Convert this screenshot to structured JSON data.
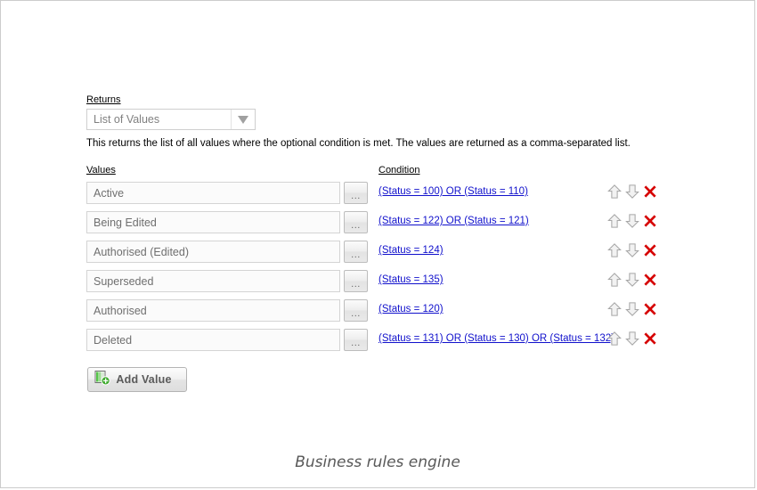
{
  "returns": {
    "label": "Returns",
    "selected_value": "List of Values",
    "dropdown_icon": "chevron-down-icon"
  },
  "description": "This returns the list of all values where the optional condition is met. The values are returned as a comma-separated list.",
  "table": {
    "headers": {
      "values": "Values",
      "condition": "Condition"
    },
    "ellipsis_label": "...",
    "row_icons": {
      "move_up": "arrow-up-icon",
      "move_down": "arrow-down-icon",
      "delete": "delete-x-icon"
    },
    "rows": [
      {
        "value": "Active",
        "condition": "(Status = 100) OR (Status = 110)"
      },
      {
        "value": "Being Edited",
        "condition": "(Status = 122) OR (Status = 121)"
      },
      {
        "value": "Authorised (Edited)",
        "condition": "(Status = 124)"
      },
      {
        "value": "Superseded",
        "condition": "(Status = 135)"
      },
      {
        "value": "Authorised",
        "condition": "(Status = 120)"
      },
      {
        "value": "Deleted",
        "condition": "(Status = 131) OR (Status = 130) OR (Status = 132)"
      }
    ]
  },
  "add_value": {
    "label": "Add Value",
    "icon": "add-value-icon"
  },
  "caption": "Business rules engine",
  "colors": {
    "link": "#1111CC",
    "delete": "#D60000",
    "page_border": "#CCCCCC",
    "input_text": "#6F6F6F"
  }
}
